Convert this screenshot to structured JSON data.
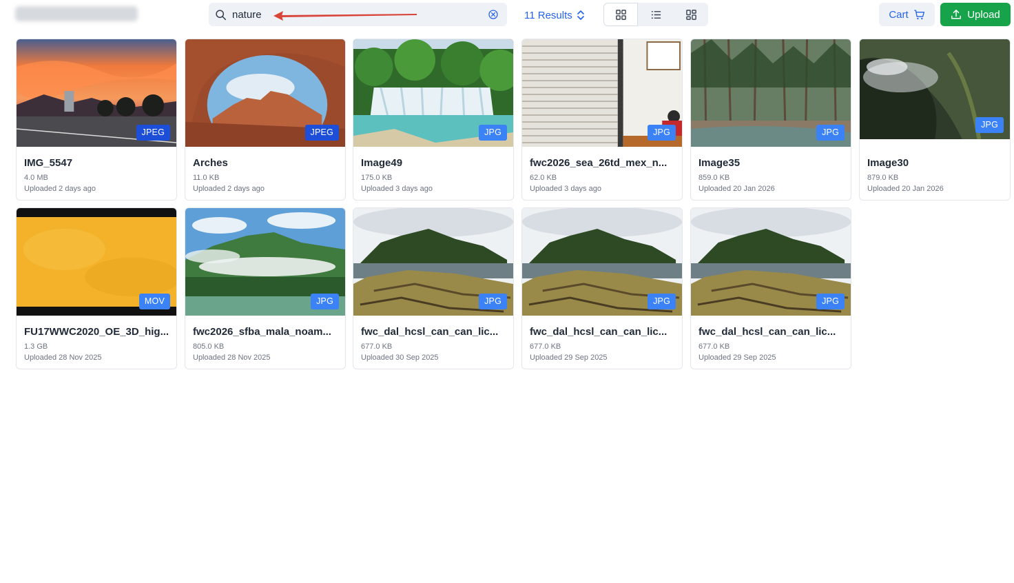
{
  "header": {
    "search": {
      "value": "nature",
      "placeholder": ""
    },
    "results_label": "11 Results",
    "cart_label": "Cart",
    "upload_label": "Upload",
    "view_modes": [
      "grid-icon",
      "list-icon",
      "masonry-icon"
    ],
    "active_view": "grid"
  },
  "colors": {
    "accent": "#2563eb",
    "upload": "#16a34a",
    "badge": "#3b82f6",
    "annotation_arrow": "#d9443a"
  },
  "assets": [
    {
      "title": "IMG_5547",
      "size": "4.0 MB",
      "uploaded": "Uploaded 2 days ago",
      "type": "JPEG",
      "thumb": "sunset"
    },
    {
      "title": "Arches",
      "size": "11.0 KB",
      "uploaded": "Uploaded 2 days ago",
      "type": "JPEG",
      "thumb": "arch"
    },
    {
      "title": "Image49",
      "size": "175.0 KB",
      "uploaded": "Uploaded 3 days ago",
      "type": "JPG",
      "thumb": "waterfall"
    },
    {
      "title": "fwc2026_sea_26td_mex_n...",
      "size": "62.0 KB",
      "uploaded": "Uploaded 3 days ago",
      "type": "JPG",
      "thumb": "office"
    },
    {
      "title": "Image35",
      "size": "859.0 KB",
      "uploaded": "Uploaded 20 Jan 2026",
      "type": "JPG",
      "thumb": "forest"
    },
    {
      "title": "Image30",
      "size": "879.0 KB",
      "uploaded": "Uploaded 20 Jan 2026",
      "type": "JPG",
      "thumb": "mist"
    },
    {
      "title": "FU17WWC2020_OE_3D_hig...",
      "size": "1.3 GB",
      "uploaded": "Uploaded 28 Nov 2025",
      "type": "MOV",
      "thumb": "yellow"
    },
    {
      "title": "fwc2026_sfba_mala_noam...",
      "size": "805.0 KB",
      "uploaded": "Uploaded 28 Nov 2025",
      "type": "JPG",
      "thumb": "mountain"
    },
    {
      "title": "fwc_dal_hcsl_can_can_lic...",
      "size": "677.0 KB",
      "uploaded": "Uploaded 30 Sep 2025",
      "type": "JPG",
      "thumb": "shore"
    },
    {
      "title": "fwc_dal_hcsl_can_can_lic...",
      "size": "677.0 KB",
      "uploaded": "Uploaded 29 Sep 2025",
      "type": "JPG",
      "thumb": "shore"
    },
    {
      "title": "fwc_dal_hcsl_can_can_lic...",
      "size": "677.0 KB",
      "uploaded": "Uploaded 29 Sep 2025",
      "type": "JPG",
      "thumb": "shore"
    }
  ]
}
